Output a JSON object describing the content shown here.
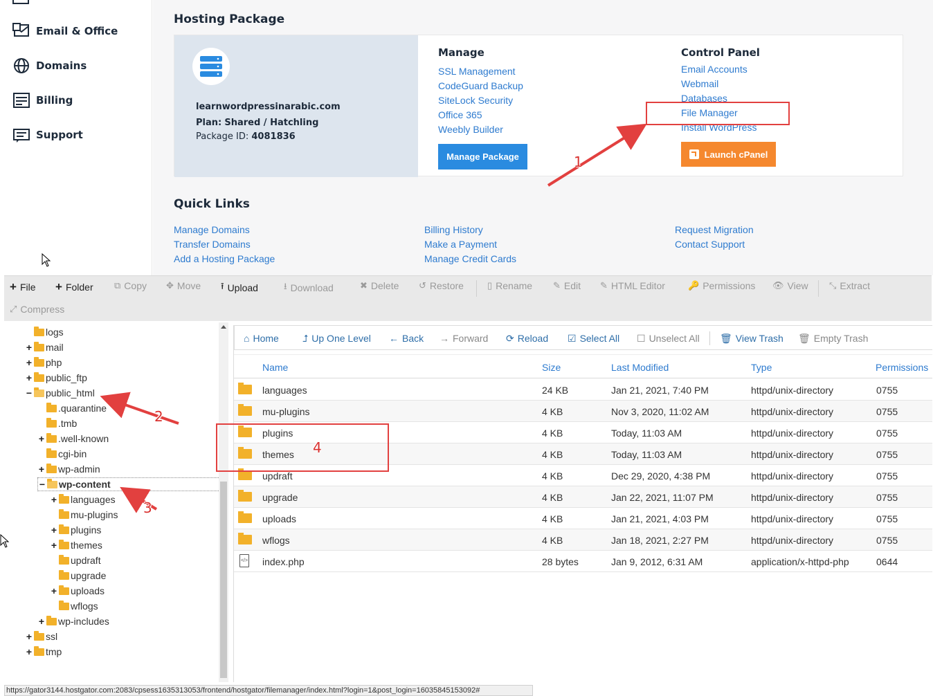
{
  "sidebar": {
    "items": [
      {
        "label": "Email & Office",
        "icon": "email-office-icon"
      },
      {
        "label": "Domains",
        "icon": "globe-icon"
      },
      {
        "label": "Billing",
        "icon": "billing-icon"
      },
      {
        "label": "Support",
        "icon": "support-icon"
      }
    ]
  },
  "hosting": {
    "title": "Hosting Package",
    "domain": "learnwordpressinarabic.com",
    "plan_label": "Plan:",
    "plan_value": "Shared / Hatchling",
    "package_id_label": "Package ID:",
    "package_id_value": "4081836",
    "manage": {
      "heading": "Manage",
      "links": [
        "SSL Management",
        "CodeGuard Backup",
        "SiteLock Security",
        "Office 365",
        "Weebly Builder"
      ],
      "button": "Manage Package"
    },
    "control_panel": {
      "heading": "Control Panel",
      "links": [
        "Email Accounts",
        "Webmail",
        "Databases",
        "File Manager",
        "Install WordPress"
      ],
      "button": "Launch cPanel"
    }
  },
  "quick_links": {
    "title": "Quick Links",
    "col1": [
      "Manage Domains",
      "Transfer Domains",
      "Add a Hosting Package"
    ],
    "col2": [
      "Billing History",
      "Make a Payment",
      "Manage Credit Cards"
    ],
    "col3": [
      "Request Migration",
      "Contact Support"
    ]
  },
  "annotations": [
    "1",
    "2",
    "3",
    "4"
  ],
  "toolbar": {
    "items": [
      {
        "label": "File",
        "glyph": "+",
        "enabled": true
      },
      {
        "label": "Folder",
        "glyph": "+",
        "enabled": true
      },
      {
        "label": "Copy",
        "glyph": "⧉",
        "enabled": false
      },
      {
        "label": "Move",
        "glyph": "✥",
        "enabled": false
      },
      {
        "label": "Upload",
        "glyph": "⭱",
        "enabled": true
      },
      {
        "label": "Download",
        "glyph": "⭳",
        "enabled": false
      },
      {
        "label": "Delete",
        "glyph": "✖",
        "enabled": false
      },
      {
        "label": "Restore",
        "glyph": "↺",
        "enabled": false
      },
      {
        "label": "Rename",
        "glyph": "▯",
        "enabled": false
      },
      {
        "label": "Edit",
        "glyph": "✎",
        "enabled": false
      },
      {
        "label": "HTML Editor",
        "glyph": "✎",
        "enabled": false
      },
      {
        "label": "Permissions",
        "glyph": "🔑",
        "enabled": false
      },
      {
        "label": "View",
        "glyph": "👁",
        "enabled": false
      },
      {
        "label": "Extract",
        "glyph": "⤡",
        "enabled": false
      },
      {
        "label": "Compress",
        "glyph": "⤢",
        "enabled": false
      }
    ]
  },
  "tree": [
    {
      "label": "logs",
      "depth": 0,
      "toggle": ""
    },
    {
      "label": "mail",
      "depth": 0,
      "toggle": "+"
    },
    {
      "label": "php",
      "depth": 0,
      "toggle": "+"
    },
    {
      "label": "public_ftp",
      "depth": 0,
      "toggle": "+"
    },
    {
      "label": "public_html",
      "depth": 0,
      "toggle": "−"
    },
    {
      "label": ".quarantine",
      "depth": 1,
      "toggle": ""
    },
    {
      "label": ".tmb",
      "depth": 1,
      "toggle": ""
    },
    {
      "label": ".well-known",
      "depth": 1,
      "toggle": "+"
    },
    {
      "label": "cgi-bin",
      "depth": 1,
      "toggle": ""
    },
    {
      "label": "wp-admin",
      "depth": 1,
      "toggle": "+"
    },
    {
      "label": "wp-content",
      "depth": 1,
      "toggle": "−"
    },
    {
      "label": "languages",
      "depth": 2,
      "toggle": "+"
    },
    {
      "label": "mu-plugins",
      "depth": 2,
      "toggle": ""
    },
    {
      "label": "plugins",
      "depth": 2,
      "toggle": "+"
    },
    {
      "label": "themes",
      "depth": 2,
      "toggle": "+"
    },
    {
      "label": "updraft",
      "depth": 2,
      "toggle": ""
    },
    {
      "label": "upgrade",
      "depth": 2,
      "toggle": ""
    },
    {
      "label": "uploads",
      "depth": 2,
      "toggle": "+"
    },
    {
      "label": "wflogs",
      "depth": 2,
      "toggle": ""
    },
    {
      "label": "wp-includes",
      "depth": 1,
      "toggle": "+"
    },
    {
      "label": "ssl",
      "depth": 0,
      "toggle": "+"
    },
    {
      "label": "tmp",
      "depth": 0,
      "toggle": "+"
    }
  ],
  "navbar": {
    "items": [
      {
        "label": "Home",
        "glyph": "⌂",
        "enabled": true
      },
      {
        "label": "Up One Level",
        "glyph": "⮥",
        "enabled": true
      },
      {
        "label": "Back",
        "glyph": "←",
        "enabled": true
      },
      {
        "label": "Forward",
        "glyph": "→",
        "enabled": false
      },
      {
        "label": "Reload",
        "glyph": "⟳",
        "enabled": true
      },
      {
        "label": "Select All",
        "glyph": "☑",
        "enabled": true
      },
      {
        "label": "Unselect All",
        "glyph": "☐",
        "enabled": false
      },
      {
        "label": "View Trash",
        "glyph": "🗑",
        "enabled": true
      },
      {
        "label": "Empty Trash",
        "glyph": "🗑",
        "enabled": false
      }
    ]
  },
  "table": {
    "headers": [
      "Name",
      "Size",
      "Last Modified",
      "Type",
      "Permissions"
    ],
    "rows": [
      {
        "name": "languages",
        "size": "24 KB",
        "modified": "Jan 21, 2021, 7:40 PM",
        "type": "httpd/unix-directory",
        "perms": "0755",
        "kind": "folder"
      },
      {
        "name": "mu-plugins",
        "size": "4 KB",
        "modified": "Nov 3, 2020, 11:02 AM",
        "type": "httpd/unix-directory",
        "perms": "0755",
        "kind": "folder"
      },
      {
        "name": "plugins",
        "size": "4 KB",
        "modified": "Today, 11:03 AM",
        "type": "httpd/unix-directory",
        "perms": "0755",
        "kind": "folder"
      },
      {
        "name": "themes",
        "size": "4 KB",
        "modified": "Today, 11:03 AM",
        "type": "httpd/unix-directory",
        "perms": "0755",
        "kind": "folder"
      },
      {
        "name": "updraft",
        "size": "4 KB",
        "modified": "Dec 29, 2020, 4:38 PM",
        "type": "httpd/unix-directory",
        "perms": "0755",
        "kind": "folder"
      },
      {
        "name": "upgrade",
        "size": "4 KB",
        "modified": "Jan 22, 2021, 11:07 PM",
        "type": "httpd/unix-directory",
        "perms": "0755",
        "kind": "folder"
      },
      {
        "name": "uploads",
        "size": "4 KB",
        "modified": "Jan 21, 2021, 4:03 PM",
        "type": "httpd/unix-directory",
        "perms": "0755",
        "kind": "folder"
      },
      {
        "name": "wflogs",
        "size": "4 KB",
        "modified": "Jan 18, 2021, 2:27 PM",
        "type": "httpd/unix-directory",
        "perms": "0755",
        "kind": "folder"
      },
      {
        "name": "index.php",
        "size": "28 bytes",
        "modified": "Jan 9, 2012, 6:31 AM",
        "type": "application/x-httpd-php",
        "perms": "0644",
        "kind": "file"
      }
    ]
  },
  "status_url": "https://gator3144.hostgator.com:2083/cpsess1635313053/frontend/hostgator/filemanager/index.html?login=1&post_login=16035845153092#",
  "colors": {
    "link": "#2e7bcf",
    "accent_blue": "#2a8be0",
    "accent_orange": "#f5882e",
    "annotation_red": "#e2403f",
    "folder": "#f2b12a"
  }
}
